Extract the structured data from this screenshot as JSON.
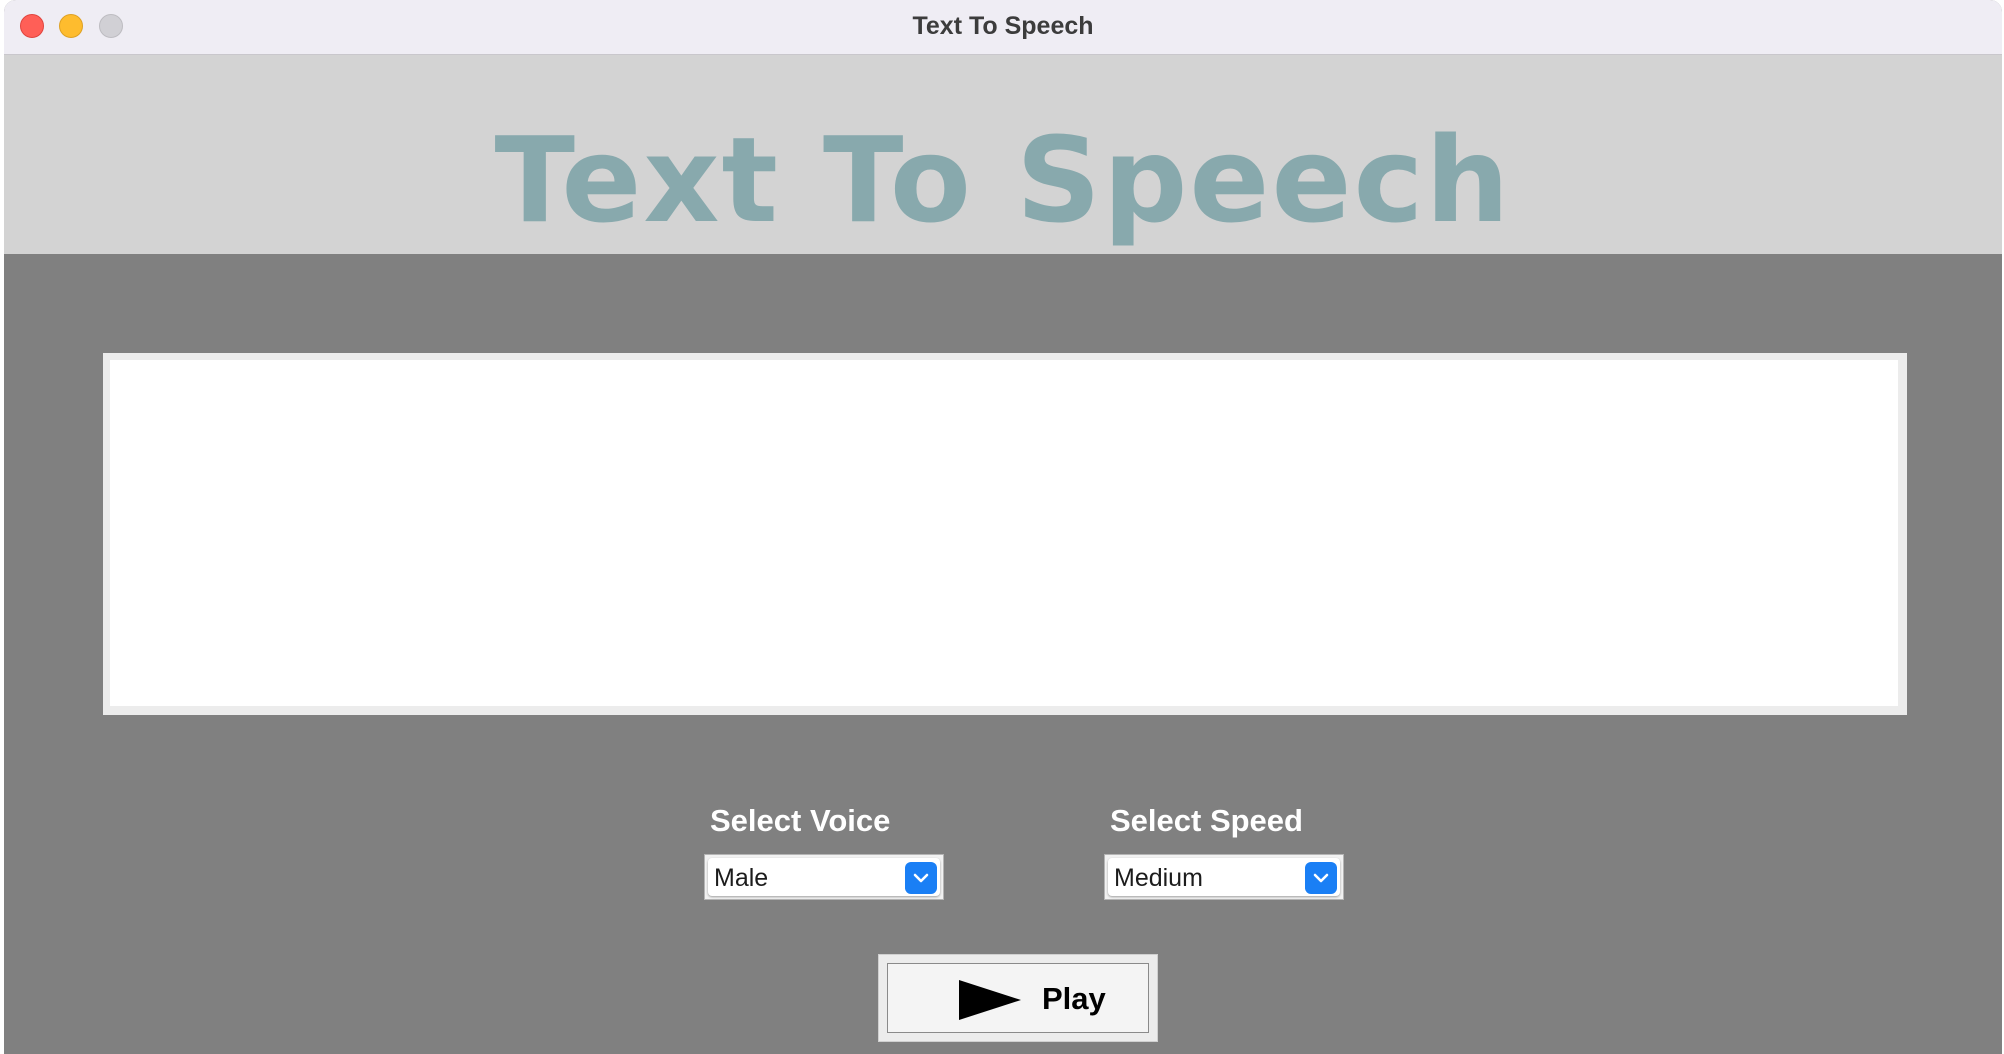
{
  "window": {
    "title": "Text To Speech"
  },
  "banner": {
    "title": "Text To Speech"
  },
  "text_input": {
    "value": "",
    "placeholder": ""
  },
  "voice": {
    "label": "Select Voice",
    "selected": "Male"
  },
  "speed": {
    "label": "Select Speed",
    "selected": "Medium"
  },
  "play_button": {
    "label": "Play",
    "icon": "play-icon"
  },
  "colors": {
    "banner_text": "#88a9ad",
    "banner_background": "#d3d3d3",
    "window_background": "#808080",
    "select_arrow": "#1a7ff5"
  }
}
